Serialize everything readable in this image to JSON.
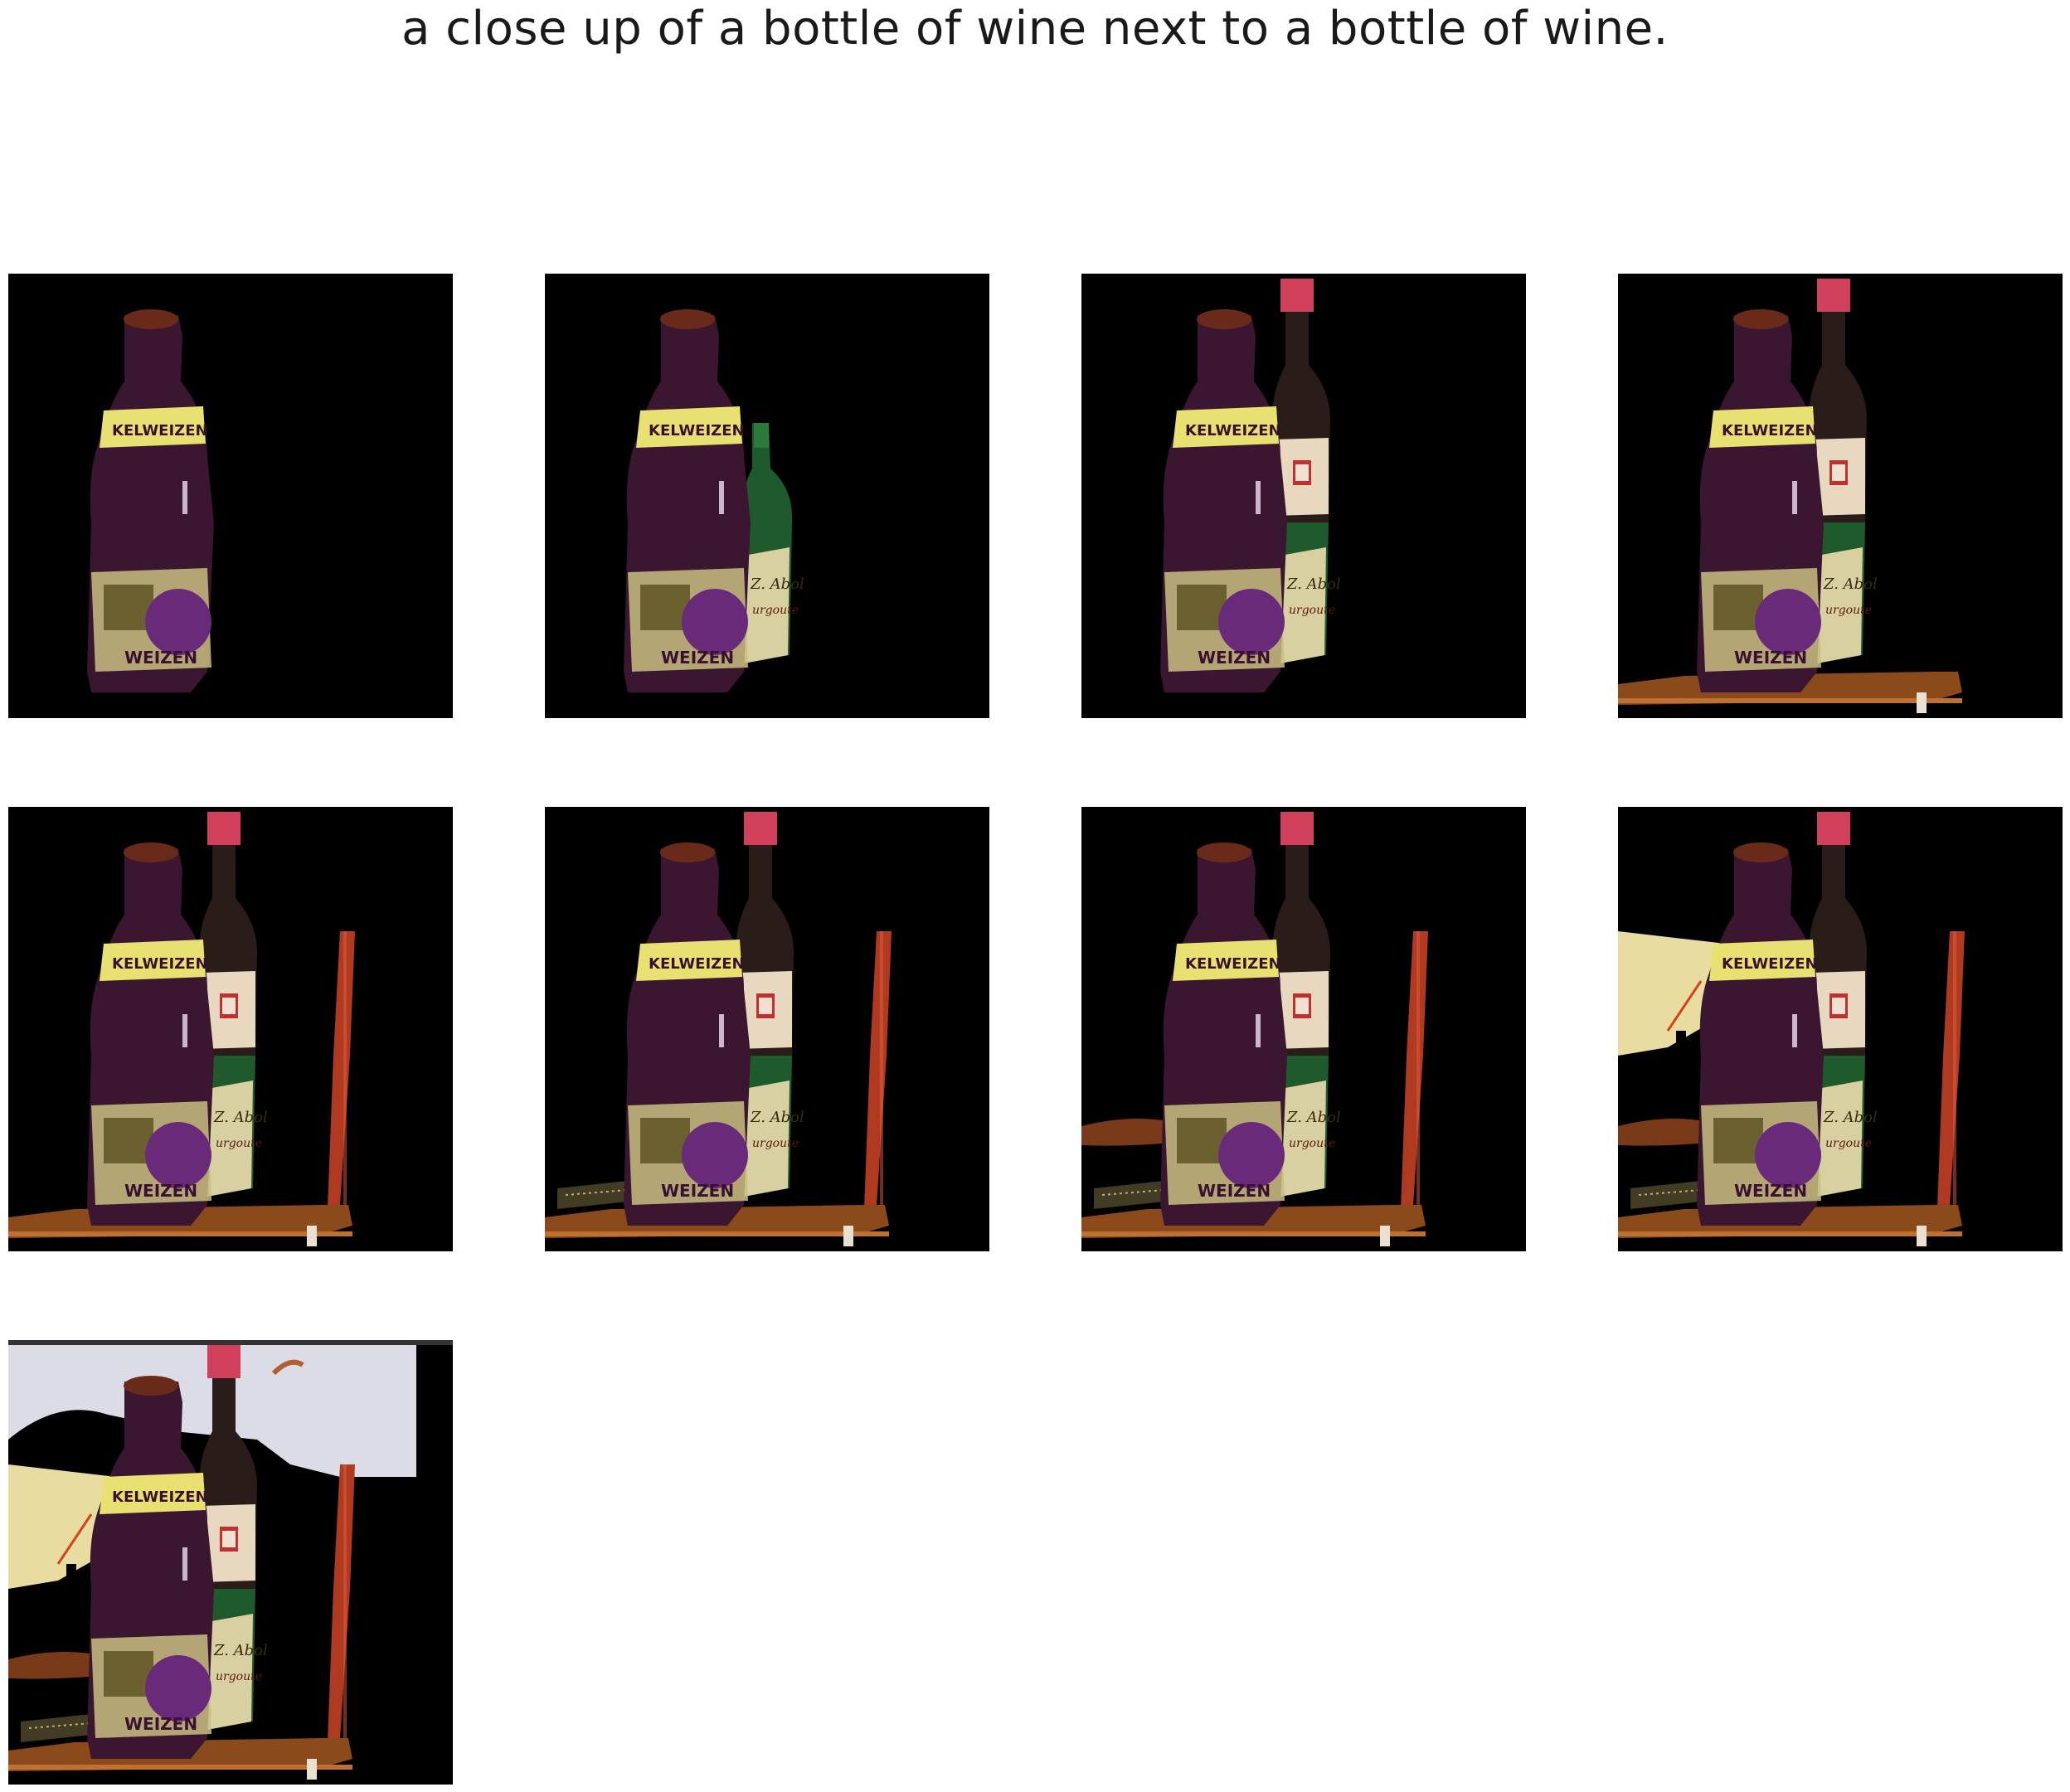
{
  "caption": "a close up of a bottle of wine next to a bottle of wine.",
  "panels": [
    {
      "index": 1,
      "segments": [
        "beer-bottle"
      ]
    },
    {
      "index": 2,
      "segments": [
        "beer-bottle",
        "green-bottle"
      ]
    },
    {
      "index": 3,
      "segments": [
        "beer-bottle",
        "green-bottle",
        "red-cap-bottle"
      ]
    },
    {
      "index": 4,
      "segments": [
        "beer-bottle",
        "green-bottle",
        "red-cap-bottle",
        "table-edge"
      ]
    },
    {
      "index": 5,
      "segments": [
        "beer-bottle",
        "green-bottle",
        "red-cap-bottle",
        "table-edge",
        "chair-post"
      ]
    },
    {
      "index": 6,
      "segments": [
        "beer-bottle",
        "green-bottle",
        "red-cap-bottle",
        "table-edge",
        "chair-post",
        "shelf-speckle"
      ]
    },
    {
      "index": 7,
      "segments": [
        "beer-bottle",
        "green-bottle",
        "red-cap-bottle",
        "table-edge",
        "chair-post",
        "shelf-speckle",
        "floor-strip"
      ]
    },
    {
      "index": 8,
      "segments": [
        "beer-bottle",
        "green-bottle",
        "red-cap-bottle",
        "table-edge",
        "chair-post",
        "shelf-speckle",
        "floor-strip",
        "cream-wall"
      ]
    },
    {
      "index": 9,
      "segments": [
        "beer-bottle",
        "green-bottle",
        "red-cap-bottle",
        "table-edge",
        "chair-post",
        "shelf-speckle",
        "floor-strip",
        "cream-wall",
        "sky-background"
      ]
    }
  ],
  "labels": {
    "beer_label": "WEIZEN",
    "beer_neck": "KELWEIZEN"
  },
  "colors": {
    "background": "#000000",
    "beer_glass": "#3a1630",
    "beer_label": "#e8e070",
    "green_glass": "#1f5a2c",
    "wine_cap": "#d0405a",
    "wine_glass": "#2a1c18",
    "wine_label": "#e8d8c0",
    "table": "#8a4a1a",
    "chair": "#b03a20",
    "wall": "#e8dca0",
    "sky": "#dcdce6"
  }
}
